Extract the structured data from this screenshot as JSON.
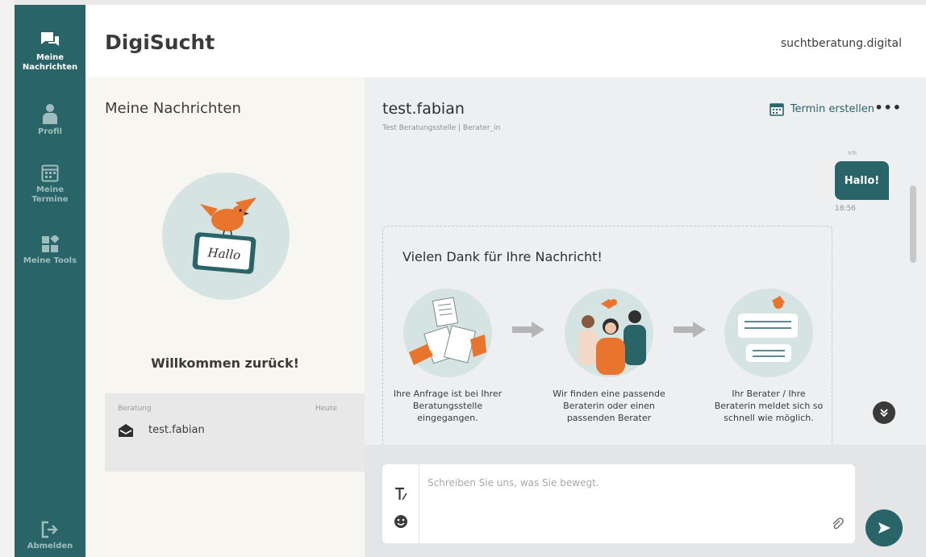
{
  "app": {
    "brand": "DigiSucht",
    "domain": "suchtberatung.digital"
  },
  "sidebar": {
    "items": [
      {
        "line1": "Meine",
        "line2": "Nachrichten",
        "icon": "chat-bubbles-icon",
        "active": true
      },
      {
        "line1": "Profil",
        "line2": "",
        "icon": "person-icon",
        "active": false
      },
      {
        "line1": "Meine",
        "line2": "Termine",
        "icon": "calendar-icon",
        "active": false
      },
      {
        "line1": "Meine Tools",
        "line2": "",
        "icon": "tools-grid-icon",
        "active": false
      }
    ],
    "logout": "Abmelden"
  },
  "list": {
    "title": "Meine Nachrichten",
    "illustration_text": "Hallo",
    "welcome": "Willkommen zurück!",
    "session": {
      "category": "Beratung",
      "date": "Heute",
      "name": "test.fabian"
    }
  },
  "chat": {
    "name": "test.fabian",
    "subtitle": "Test Beratungsstelle  |  Berater_in",
    "termin_label": "Termin erstellen",
    "more": "•••",
    "sender_label": "Ich",
    "message": {
      "text": "Hallo!",
      "time": "18:56"
    },
    "info_title": "Vielen Dank für Ihre Nachricht!",
    "steps": [
      {
        "text": "Ihre Anfrage ist bei Ihrer Beratungsstelle eingegangen."
      },
      {
        "text": "Wir finden eine passende Beraterin oder einen passenden Berater"
      },
      {
        "text": "Ihr Berater / Ihre Beraterin meldet sich so schnell wie möglich."
      }
    ],
    "composer_placeholder": "Schreiben Sie uns, was Sie bewegt."
  },
  "colors": {
    "primary": "#296468",
    "accent": "#e8742d",
    "illustration_bg": "#d5e4e2"
  }
}
